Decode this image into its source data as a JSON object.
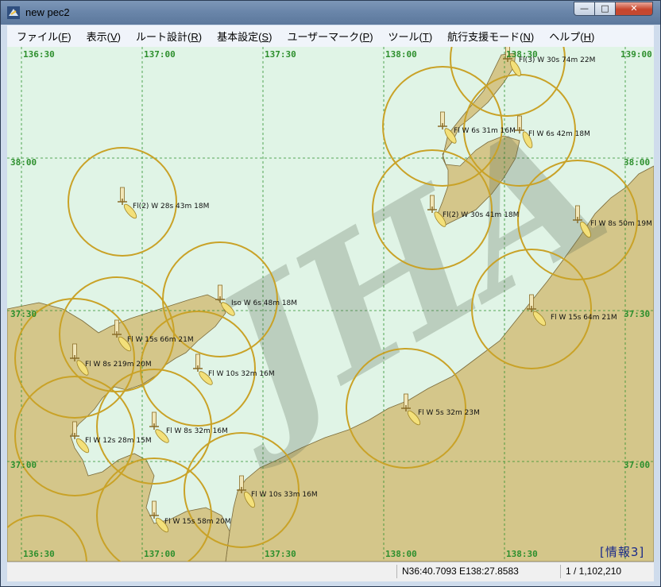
{
  "window": {
    "title": "new pec2"
  },
  "controls": {
    "minimize": "—",
    "maximize": "□",
    "close": "✕"
  },
  "menu": [
    {
      "label": "ファイル(",
      "key": "F",
      "suffix": ")"
    },
    {
      "label": "表示(",
      "key": "V",
      "suffix": ")"
    },
    {
      "label": "ルート設計(",
      "key": "R",
      "suffix": ")"
    },
    {
      "label": "基本設定(",
      "key": "S",
      "suffix": ")"
    },
    {
      "label": "ユーザーマーク(",
      "key": "P",
      "suffix": ")"
    },
    {
      "label": "ツール(",
      "key": "T",
      "suffix": ")"
    },
    {
      "label": "航行支援モード(",
      "key": "N",
      "suffix": ")"
    },
    {
      "label": "ヘルプ(",
      "key": "H",
      "suffix": ")"
    }
  ],
  "map": {
    "colors": {
      "sea": "#e0f4e6",
      "land": "#d4c68a",
      "grid": "#2d8f2d",
      "range_ring": "#c9a227",
      "lighthouse": "#8a6d28",
      "watermark": "#5f6d56"
    },
    "lon_labels_top": [
      "136:30",
      "137:00",
      "137:30",
      "138:00",
      "138:30",
      "139:00"
    ],
    "lon_labels_bottom": [
      "136:30",
      "137:00",
      "137:30",
      "138:00",
      "138:30"
    ],
    "lat_labels_left": [
      "38:00",
      "37:30",
      "37:00"
    ],
    "lat_labels_right": [
      "38:00",
      "37:30",
      "37:00"
    ],
    "watermark": "JHA",
    "lights": [
      "Fl(3) W 30s 74m 22M",
      "Fl W 6s 31m 16M",
      "Fl W 6s 42m 18M",
      "Fl(2) W 28s 43m 18M",
      "Fl(2) W 30s 41m 18M",
      "Fl W 8s 50m 19M",
      "Iso W 6s 48m 18M",
      "Fl W 15s 64m 21M",
      "Fl W 15s 66m 21M",
      "Fl W 8s 219m 20M",
      "Fl W 10s 32m 16M",
      "Fl W 5s 32m 23M",
      "Fl W 8s 32m 16M",
      "Fl W 12s 28m 15M",
      "Fl W 10s 33m 16M",
      "Fl W 15s 58m 20M"
    ],
    "info_label": "[情報3]"
  },
  "status": {
    "coords": "N36:40.7093 E138:27.8583",
    "scale": "1 / 1,102,210"
  }
}
